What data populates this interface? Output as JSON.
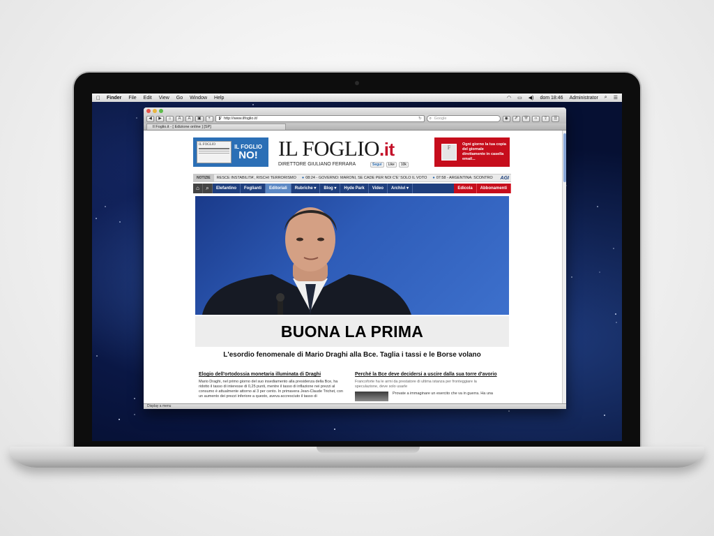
{
  "menubar": {
    "apple": "",
    "items": [
      "Finder",
      "File",
      "Edit",
      "View",
      "Go",
      "Window",
      "Help"
    ],
    "clock": "dom 18:46",
    "user": "Administrator"
  },
  "browser": {
    "url": "http://www.ilfoglio.it/",
    "search_placeholder": "Google",
    "tab_title": "Il Foglio.it - [ Edizione online ] [SP]",
    "status_text": "Display a menu"
  },
  "page": {
    "ad_left": {
      "paper_label": "IL FOGLIO",
      "line1": "IL FOGLIO",
      "line2": "NO!"
    },
    "logo": {
      "name": "IL FOGLIO",
      "ext": ".it",
      "director": "DIRETTORE GIULIANO FERRARA"
    },
    "social": {
      "follow": "Segui",
      "like": "Like",
      "count": "10k"
    },
    "ad_right": {
      "stamp": "F",
      "text": "Ogni giorno la tua copia del giornale direttamente in casella email..."
    },
    "ticker": {
      "label": "NOTIZIE",
      "items": [
        "RESCE INSTABILITA', RISCHI TERRORISMO",
        "08:24 - GOVERNO: MARONI, SE CADE PER NOI C'E' SOLO IL VOTO",
        "07:58 - ARGENTINA: SCONTRO"
      ],
      "source": "AGI"
    },
    "nav": {
      "items": [
        "Elefantino",
        "Foglianti",
        "Editoriali",
        "Rubriche ▾",
        "Blog ▾",
        "Hyde Park",
        "Video",
        "Archivi ▾"
      ],
      "red_items": [
        "Edicola",
        "Abbonamenti"
      ]
    },
    "headline": "BUONA LA PRIMA",
    "subhead": "L'esordio fenomenale di Mario Draghi alla Bce. Taglia i tassi e le Borse volano",
    "articles": {
      "left": {
        "title": "Elogio dell'ortodossia monetaria illuminata di Draghi",
        "body": "Mario Draghi, nel primo giorno del suo insediamento alla presidenza della Bce, ha ridotto il tasso di interesse di 0,25 punti, mentre il tasso di inflazione nei prezzi al consumo è attualmente attorno al 3 per cento. In primavera Jean-Claude Trichet, con un aumento dei prezzi inferiore a questo, aveva accresciuto il tasso di"
      },
      "right": {
        "title": "Perché la Bce deve decidersi a uscire dalla sua torre d'avorio",
        "summary": "Francoforte ha le armi da prestatore di ultima istanza per fronteggiare la speculazione, deve solo usarle",
        "body": "Provate a immaginare un esercito che va in guerra. Ha una"
      }
    }
  }
}
